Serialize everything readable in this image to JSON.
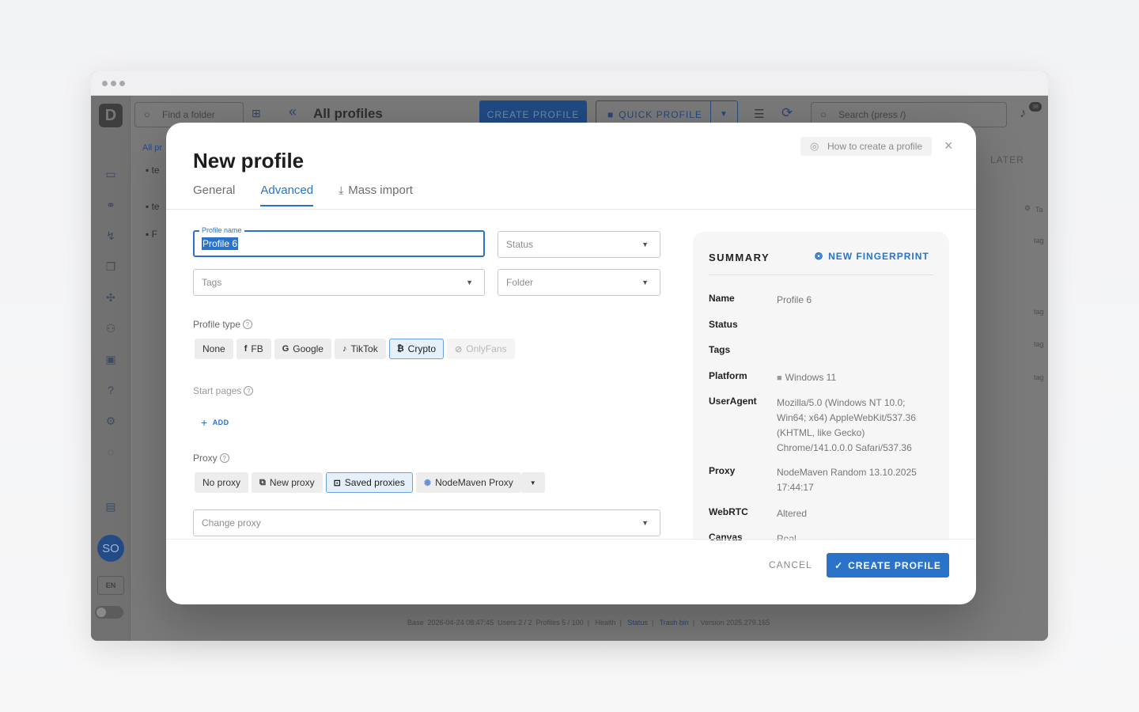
{
  "background": {
    "folder_search_placeholder": "Find a folder",
    "page_title": "All profiles",
    "create_profile": "CREATE PROFILE",
    "quick_profile": "QUICK PROFILE",
    "search_placeholder": "Search (press /)",
    "notification_count": "38",
    "tree_head": "All pr",
    "tree_items": [
      "te",
      "te",
      "F"
    ],
    "later": "LATER",
    "row_tag": "tag",
    "table_header_tag": "Ta",
    "avatar_initials": "SO",
    "language": "EN",
    "footer": {
      "base": "Base",
      "datetime": "2026-04-24 08:47:45",
      "users": "Users 2 / 2",
      "profiles": "Profiles 5 / 100",
      "health": "Health",
      "status": "Status",
      "trash": "Trash bin",
      "version": "Version 2025.279.165"
    }
  },
  "modal": {
    "title": "New profile",
    "help_button": "How to create a profile",
    "close": "×",
    "tabs": [
      {
        "label": "General"
      },
      {
        "label": "Advanced"
      },
      {
        "label": "Mass import"
      }
    ],
    "profile_name_label": "Profile name",
    "profile_name_value": "Profile 6",
    "status_placeholder": "Status",
    "tags_placeholder": "Tags",
    "folder_placeholder": "Folder",
    "profile_type_label": "Profile type",
    "profile_types": [
      "None",
      "FB",
      "Google",
      "TikTok",
      "Crypto",
      "OnlyFans"
    ],
    "start_pages_label": "Start pages",
    "add_label": "ADD",
    "proxy_label": "Proxy",
    "proxy_options": [
      "No proxy",
      "New proxy",
      "Saved proxies",
      "NodeMaven Proxy"
    ],
    "change_proxy_placeholder": "Change proxy",
    "cancel": "CANCEL",
    "create": "CREATE PROFILE"
  },
  "summary": {
    "title": "SUMMARY",
    "new_fingerprint": "NEW FINGERPRINT",
    "rows": [
      {
        "key": "Name",
        "value": "Profile 6"
      },
      {
        "key": "Status",
        "value": ""
      },
      {
        "key": "Tags",
        "value": ""
      },
      {
        "key": "Platform",
        "value": "Windows 11"
      },
      {
        "key": "UserAgent",
        "value": "Mozilla/5.0 (Windows NT 10.0; Win64; x64) AppleWebKit/537.36 (KHTML, like Gecko) Chrome/141.0.0.0 Safari/537.36"
      },
      {
        "key": "Proxy",
        "value": "NodeMaven Random 13.10.2025 17:44:17"
      },
      {
        "key": "WebRTC",
        "value": "Altered"
      },
      {
        "key": "Canvas",
        "value": "Real"
      }
    ]
  },
  "colors": {
    "accent": "#2a73c9",
    "overlay": "#7a7a7a"
  }
}
